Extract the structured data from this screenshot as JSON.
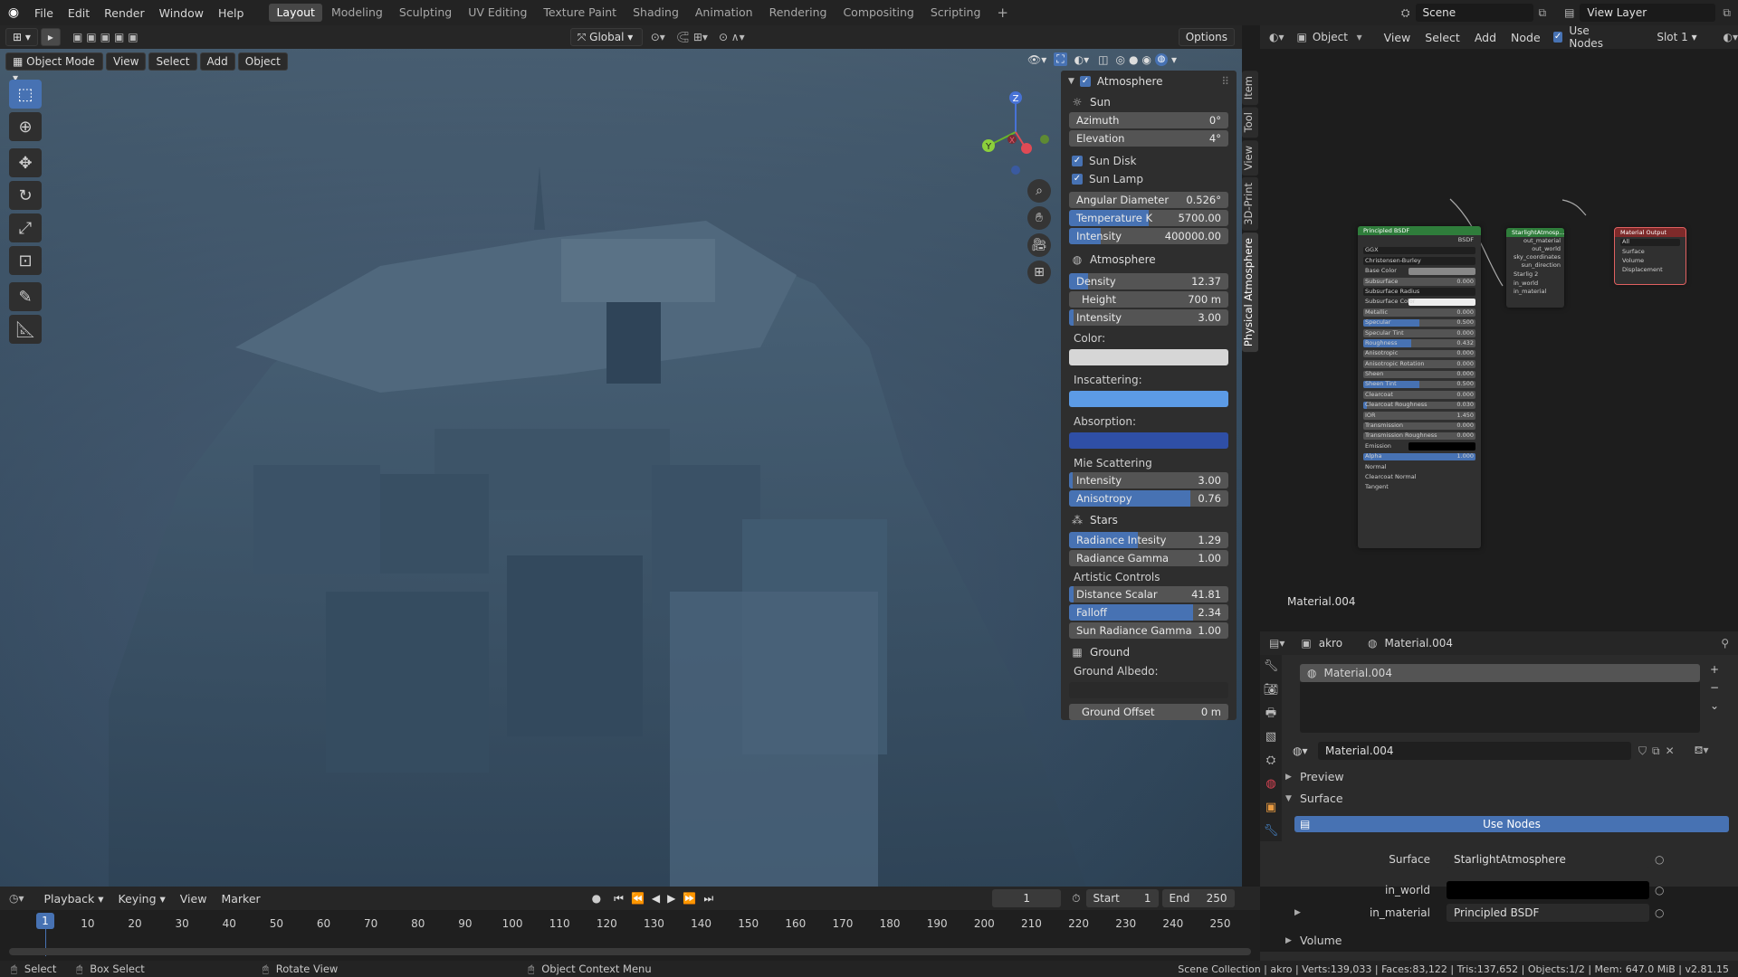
{
  "menu": {
    "items": [
      "File",
      "Edit",
      "Render",
      "Window",
      "Help"
    ]
  },
  "workspaces": [
    "Layout",
    "Modeling",
    "Sculpting",
    "UV Editing",
    "Texture Paint",
    "Shading",
    "Animation",
    "Rendering",
    "Compositing",
    "Scripting"
  ],
  "top_right": {
    "scene": "Scene",
    "view_layer": "View Layer"
  },
  "viewport_header": {
    "transform": "Global",
    "options": "Options",
    "mode": "Object Mode",
    "menus": [
      "View",
      "Select",
      "Add",
      "Object"
    ]
  },
  "gizmo": {
    "z": "Z",
    "y": "Y",
    "x": "X"
  },
  "npanel": {
    "tabs": [
      "Item",
      "Tool",
      "View",
      "3D-Print",
      "Physical Atmosphere"
    ],
    "header": "Atmosphere",
    "sun": {
      "title": "Sun",
      "azimuth_label": "Azimuth",
      "azimuth": "0°",
      "elevation_label": "Elevation",
      "elevation": "4°"
    },
    "sun_disk": "Sun Disk",
    "sun_lamp": "Sun Lamp",
    "angular": {
      "label": "Angular Diameter",
      "value": "0.526°"
    },
    "temperature": {
      "label": "Temperature K",
      "value": "5700.00",
      "fill": 0.5
    },
    "sun_intensity": {
      "label": "Intensity",
      "value": "400000.00",
      "fill": 0.2
    },
    "atmo": {
      "title": "Atmosphere",
      "density": {
        "label": "Density",
        "value": "12.37",
        "fill": 0.12
      },
      "height": {
        "label": "Height",
        "value": "700 m"
      },
      "intensity": {
        "label": "Intensity",
        "value": "3.00",
        "fill": 0.03
      },
      "color": "Color:",
      "inscattering": "Inscattering:",
      "absorption": "Absorption:"
    },
    "mie": {
      "title": "Mie Scattering",
      "intensity": {
        "label": "Intensity",
        "value": "3.00",
        "fill": 0.02
      },
      "anisotropy": {
        "label": "Anisotropy",
        "value": "0.76",
        "fill": 0.76
      }
    },
    "stars": {
      "title": "Stars",
      "radiance_intensity": {
        "label": "Radiance Intesity",
        "value": "1.29",
        "fill": 0.43
      },
      "radiance_gamma": {
        "label": "Radiance Gamma",
        "value": "1.00",
        "fill": 0.0
      }
    },
    "artistic": {
      "title": "Artistic Controls",
      "distance": {
        "label": "Distance Scalar",
        "value": "41.81",
        "fill": 0.03
      },
      "falloff": {
        "label": "Falloff",
        "value": "2.34",
        "fill": 0.78
      },
      "sun_radiance": {
        "label": "Sun Radiance Gamma",
        "value": "1.00",
        "fill": 0.0
      }
    },
    "ground": {
      "title": "Ground",
      "albedo": "Ground Albedo:",
      "offset_label": "Ground Offset",
      "offset": "0 m"
    }
  },
  "node_header": {
    "mode": "Object",
    "menus": [
      "View",
      "Select",
      "Add",
      "Node"
    ],
    "use_nodes": "Use Nodes",
    "slot": "Slot 1"
  },
  "nodes": {
    "bsdf": {
      "title": "Principled BSDF",
      "out": "BSDF",
      "dist": "GGX",
      "sss": "Christensen-Burley",
      "rows": [
        {
          "label": "Base Color",
          "value": "",
          "fill": 0
        },
        {
          "label": "Subsurface",
          "value": "0.000",
          "fill": 0
        },
        {
          "label": "Subsurface Radius",
          "value": "",
          "fill": 0
        },
        {
          "label": "Subsurface Color",
          "value": "",
          "fill": 0
        },
        {
          "label": "Metallic",
          "value": "0.000",
          "fill": 0
        },
        {
          "label": "Specular",
          "value": "0.500",
          "fill": 0.5
        },
        {
          "label": "Specular Tint",
          "value": "0.000",
          "fill": 0
        },
        {
          "label": "Roughness",
          "value": "0.432",
          "fill": 0.43
        },
        {
          "label": "Anisotropic",
          "value": "0.000",
          "fill": 0
        },
        {
          "label": "Anisotropic Rotation",
          "value": "0.000",
          "fill": 0
        },
        {
          "label": "Sheen",
          "value": "0.000",
          "fill": 0
        },
        {
          "label": "Sheen Tint",
          "value": "0.500",
          "fill": 0.5
        },
        {
          "label": "Clearcoat",
          "value": "0.000",
          "fill": 0
        },
        {
          "label": "Clearcoat Roughness",
          "value": "0.030",
          "fill": 0.03
        },
        {
          "label": "IOR",
          "value": "1.450",
          "fill": 0
        },
        {
          "label": "Transmission",
          "value": "0.000",
          "fill": 0
        },
        {
          "label": "Transmission Roughness",
          "value": "0.000",
          "fill": 0
        },
        {
          "label": "Emission",
          "value": "",
          "fill": 0
        },
        {
          "label": "Alpha",
          "value": "1.000",
          "fill": 1
        },
        {
          "label": "Normal",
          "value": "",
          "fill": 0
        },
        {
          "label": "Clearcoat Normal",
          "value": "",
          "fill": 0
        },
        {
          "label": "Tangent",
          "value": "",
          "fill": 0
        }
      ]
    },
    "starlight": {
      "title": "StarlightAtmosp...",
      "outs": [
        "out_material",
        "out_world",
        "sky_coordinates",
        "sun_direction"
      ],
      "sel": "Starlig",
      "num": "2",
      "ins": [
        "in_world",
        "in_material"
      ]
    },
    "output": {
      "title": "Material Output",
      "target": "All",
      "ins": [
        "Surface",
        "Volume",
        "Displacement"
      ]
    }
  },
  "node_label": "Material.004",
  "props": {
    "object": "akro",
    "material": "Material.004",
    "slot_item": "Material.004",
    "mat_field": "Material.004",
    "preview": "Preview",
    "surface": "Surface",
    "use_nodes": "Use Nodes",
    "surface_label": "Surface",
    "surface_value": "StarlightAtmosphere",
    "in_world": "in_world",
    "in_material": "in_material",
    "in_material_value": "Principled BSDF",
    "volume": "Volume"
  },
  "timeline": {
    "menus": [
      "Playback",
      "Keying",
      "View",
      "Marker"
    ],
    "frame": "1",
    "start_label": "Start",
    "start": "1",
    "end_label": "End",
    "end": "250",
    "current": "1",
    "ticks": [
      "10",
      "20",
      "30",
      "40",
      "50",
      "60",
      "70",
      "80",
      "90",
      "100",
      "110",
      "120",
      "130",
      "140",
      "150",
      "160",
      "170",
      "180",
      "190",
      "200",
      "210",
      "220",
      "230",
      "240",
      "250"
    ]
  },
  "status": {
    "select": "Select",
    "box_select": "Box Select",
    "rotate": "Rotate View",
    "context": "Object Context Menu",
    "info": "Scene Collection | akro | Verts:139,033 | Faces:83,122 | Tris:137,652 | Objects:1/2 | Mem: 647.0 MiB | v2.81.15"
  }
}
